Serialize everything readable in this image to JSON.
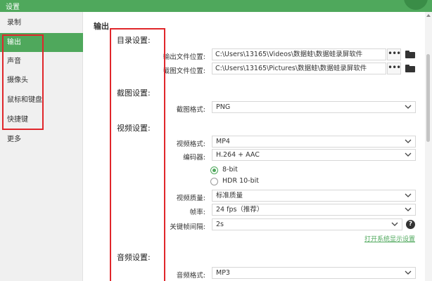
{
  "window": {
    "title": "设置"
  },
  "sidebar": {
    "items": [
      {
        "label": "录制",
        "active": false
      },
      {
        "label": "输出",
        "active": true
      },
      {
        "label": "声音",
        "active": false
      },
      {
        "label": "摄像头",
        "active": false
      },
      {
        "label": "鼠标和键盘",
        "active": false
      },
      {
        "label": "快捷键",
        "active": false
      },
      {
        "label": "更多",
        "active": false
      }
    ]
  },
  "main": {
    "title": "输出",
    "sections": {
      "directory": "目录设置:",
      "screenshot": "截图设置:",
      "video": "视频设置:",
      "audio": "音频设置:"
    },
    "output_path": {
      "label": "输出文件位置:",
      "value": "C:\\Users\\13165\\Videos\\数据蛙\\数据蛙录屏软件",
      "browse": "•••"
    },
    "screenshot_path": {
      "label": "截图文件位置:",
      "value": "C:\\Users\\13165\\Pictures\\数据蛙\\数据蛙录屏软件",
      "browse": "•••"
    },
    "screenshot_format": {
      "label": "截图格式:",
      "value": "PNG"
    },
    "video_format": {
      "label": "视频格式:",
      "value": "MP4"
    },
    "encoder": {
      "label": "编码器:",
      "value": "H.264 + AAC"
    },
    "bit_depth": {
      "options": [
        "8-bit",
        "HDR 10-bit"
      ],
      "selected": "8-bit"
    },
    "video_quality": {
      "label": "视频质量:",
      "value": "标准质量"
    },
    "frame_rate": {
      "label": "帧率:",
      "value": "24 fps（推荐）"
    },
    "keyframe_interval": {
      "label": "关键帧间隔:",
      "value": "2s"
    },
    "display_settings_link": "打开系统显示设置",
    "audio_format": {
      "label": "音频格式:",
      "value": "MP3"
    }
  },
  "colors": {
    "accent": "#4fa85c",
    "highlight_box": "#e0262b"
  }
}
